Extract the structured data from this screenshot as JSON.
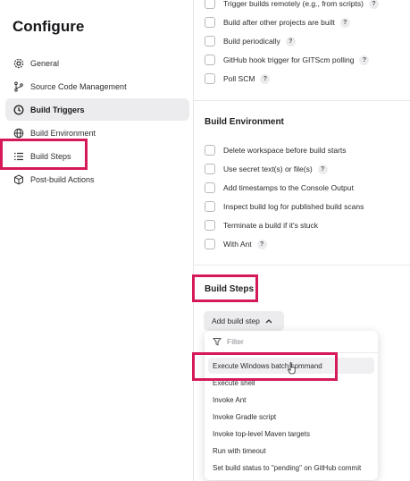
{
  "sidebar": {
    "title": "Configure",
    "items": [
      {
        "label": "General"
      },
      {
        "label": "Source Code Management"
      },
      {
        "label": "Build Triggers"
      },
      {
        "label": "Build Environment"
      },
      {
        "label": "Build Steps"
      },
      {
        "label": "Post-build Actions"
      }
    ]
  },
  "build_triggers": {
    "items": [
      {
        "label": "Trigger builds remotely (e.g., from scripts)"
      },
      {
        "label": "Build after other projects are built"
      },
      {
        "label": "Build periodically"
      },
      {
        "label": "GitHub hook trigger for GITScm polling"
      },
      {
        "label": "Poll SCM"
      }
    ]
  },
  "build_environment": {
    "title": "Build Environment",
    "items": [
      {
        "label": "Delete workspace before build starts"
      },
      {
        "label": "Use secret text(s) or file(s)"
      },
      {
        "label": "Add timestamps to the Console Output"
      },
      {
        "label": "Inspect build log for published build scans"
      },
      {
        "label": "Terminate a build if it's stuck"
      },
      {
        "label": "With Ant"
      }
    ]
  },
  "build_steps": {
    "title": "Build Steps",
    "add_button_label": "Add build step",
    "dropdown": {
      "filter_placeholder": "Filter",
      "items": [
        {
          "label": "Execute Windows batch command"
        },
        {
          "label": "Execute shell"
        },
        {
          "label": "Invoke Ant"
        },
        {
          "label": "Invoke Gradle script"
        },
        {
          "label": "Invoke top-level Maven targets"
        },
        {
          "label": "Run with timeout"
        },
        {
          "label": "Set build status to \"pending\" on GitHub commit"
        }
      ]
    }
  },
  "help_glyph": "?",
  "colors": {
    "highlight": "#d5195a",
    "active_nav_bg": "#ececee"
  }
}
